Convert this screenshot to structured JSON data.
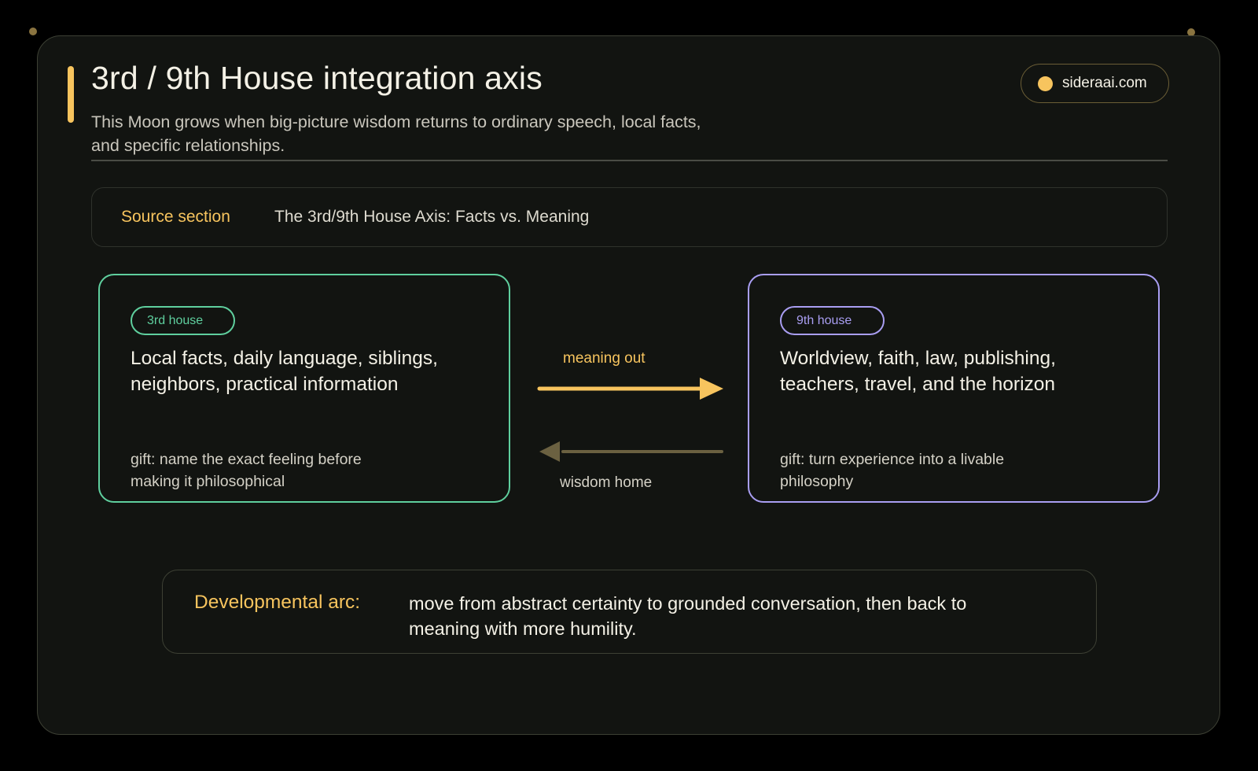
{
  "header": {
    "title": "3rd / 9th House integration axis",
    "subtitle": "This Moon grows when big-picture wisdom returns to ordinary speech, local facts, and specific relationships."
  },
  "brand": {
    "label": "sideraai.com"
  },
  "source": {
    "label": "Source section",
    "value": "The 3rd/9th House Axis: Facts vs. Meaning"
  },
  "houses": {
    "third": {
      "tag": "3rd house",
      "description": "Local facts, daily language, siblings, neighbors, practical information",
      "gift": "gift: name the exact feeling before making it philosophical"
    },
    "ninth": {
      "tag": "9th house",
      "description": "Worldview, faith, law, publishing, teachers, travel, and the horizon",
      "gift": "gift: turn experience into a livable philosophy"
    }
  },
  "flows": {
    "out": "meaning out",
    "home": "wisdom home"
  },
  "arc": {
    "label": "Developmental arc:",
    "text": "move from abstract certainty to grounded conversation, then back to meaning with more humility."
  },
  "colors": {
    "accent": "#f7c45e",
    "third_house": "#5fcf9e",
    "ninth_house": "#a99ef2",
    "return_arrow": "#6b6141",
    "background": "#121411"
  }
}
